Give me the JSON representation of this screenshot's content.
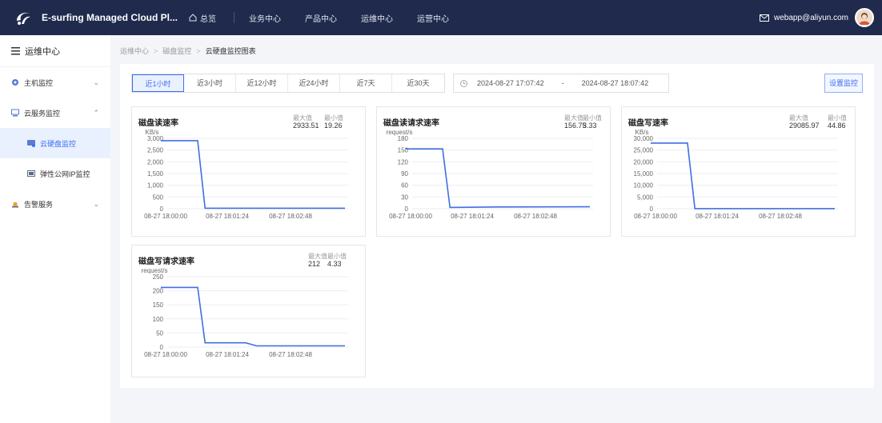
{
  "header": {
    "title": "E-surfing Managed Cloud Pl...",
    "home_label": "总览",
    "nav": [
      "业务中心",
      "产品中心",
      "运维中心",
      "运营中心"
    ],
    "user_email": "webapp@aliyun.com"
  },
  "sidebar": {
    "title": "运维中心",
    "items": [
      {
        "label": "主机监控"
      },
      {
        "label": "云服务监控"
      },
      {
        "label": "告警服务"
      }
    ],
    "sub_items": [
      {
        "label": "云硬盘监控"
      },
      {
        "label": "弹性公网IP监控"
      }
    ]
  },
  "breadcrumb": [
    "运维中心",
    "磁盘监控",
    "云硬盘监控图表"
  ],
  "toolbar": {
    "ranges": [
      "近1小时",
      "近3小时",
      "近12小时",
      "近24小时",
      "近7天",
      "近30天"
    ],
    "active_range": "近1小时",
    "start_time": "2024-08-27 17:07:42",
    "separator": "-",
    "end_time": "2024-08-27 18:07:42",
    "config_button": "设置监控"
  },
  "stat_labels": {
    "max": "最大值",
    "min": "最小值"
  },
  "colors": {
    "accent": "#3d6df2",
    "line": "#3f6fe0",
    "topbar": "#1f2a4d"
  },
  "chart_data": [
    {
      "type": "line",
      "title": "磁盘读速率",
      "unit": "KB/s",
      "max": "2933.51",
      "min": "19.26",
      "ylim": [
        0,
        3000
      ],
      "yticks": [
        "3,000",
        "2,500",
        "2,000",
        "1,500",
        "1,000",
        "500",
        "0"
      ],
      "xticks": [
        "08-27 18:00:00",
        "08-27 18:01:24",
        "08-27 18:02:48"
      ],
      "x": [
        0,
        2,
        17.5
      ],
      "y": [
        2900,
        2900,
        19.26,
        19.26
      ],
      "points": [
        [
          0,
          2900
        ],
        [
          0.2,
          2900
        ],
        [
          0.24,
          19.26
        ],
        [
          1,
          19.26
        ]
      ]
    },
    {
      "type": "line",
      "title": "磁盘读请求速率",
      "unit": "request/s",
      "max": "156.75",
      "min": "3.33",
      "ylim": [
        0,
        180
      ],
      "yticks": [
        "180",
        "150",
        "120",
        "90",
        "60",
        "30",
        "0"
      ],
      "xticks": [
        "08-27 18:00:00",
        "08-27 18:01:24",
        "08-27 18:02:48"
      ],
      "points": [
        [
          0,
          153
        ],
        [
          0.2,
          153
        ],
        [
          0.24,
          3.33
        ],
        [
          0.5,
          4.5
        ],
        [
          1,
          5
        ]
      ]
    },
    {
      "type": "line",
      "title": "磁盘写速率",
      "unit": "KB/s",
      "max": "29085.97",
      "min": "44.86",
      "ylim": [
        0,
        30000
      ],
      "yticks": [
        "30,000",
        "25,000",
        "20,000",
        "15,000",
        "10,000",
        "5,000",
        "0"
      ],
      "xticks": [
        "08-27 18:00:00",
        "08-27 18:01:24",
        "08-27 18:02:48"
      ],
      "points": [
        [
          0,
          28000
        ],
        [
          0.2,
          28000
        ],
        [
          0.24,
          44.86
        ],
        [
          1,
          44.86
        ]
      ]
    },
    {
      "type": "line",
      "title": "磁盘写请求速率",
      "unit": "request/s",
      "max": "212",
      "min": "4.33",
      "ylim": [
        0,
        250
      ],
      "yticks": [
        "250",
        "200",
        "150",
        "100",
        "50",
        "0"
      ],
      "xticks": [
        "08-27 18:00:00",
        "08-27 18:01:24",
        "08-27 18:02:48"
      ],
      "points": [
        [
          0,
          212
        ],
        [
          0.2,
          212
        ],
        [
          0.24,
          15
        ],
        [
          0.46,
          15
        ],
        [
          0.52,
          4.33
        ],
        [
          1,
          4.33
        ]
      ]
    }
  ]
}
